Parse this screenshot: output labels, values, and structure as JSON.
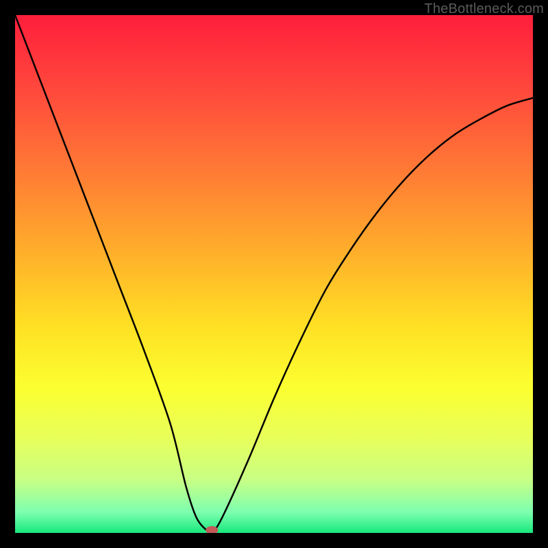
{
  "watermark": "TheBottleneck.com",
  "chart_data": {
    "type": "line",
    "title": "",
    "xlabel": "",
    "ylabel": "",
    "xlim": [
      0,
      100
    ],
    "ylim": [
      0,
      100
    ],
    "grid": false,
    "series": [
      {
        "name": "bottleneck-curve",
        "x": [
          0,
          5,
          10,
          15,
          20,
          25,
          30,
          33,
          35,
          37,
          38,
          40,
          45,
          50,
          55,
          60,
          65,
          70,
          75,
          80,
          85,
          90,
          95,
          100
        ],
        "values": [
          100,
          87,
          74,
          61,
          48,
          35,
          21,
          9,
          3,
          0.5,
          0,
          3,
          14,
          26,
          37,
          47,
          55,
          62,
          68,
          73,
          77,
          80,
          82.5,
          84
        ]
      }
    ],
    "marker": {
      "name": "optimal-point",
      "x": 38,
      "y": 0,
      "color": "#c25a57"
    },
    "gradient_stops": [
      {
        "offset": 0.0,
        "color": "#ff1e3c"
      },
      {
        "offset": 0.15,
        "color": "#ff4a3c"
      },
      {
        "offset": 0.3,
        "color": "#ff7a35"
      },
      {
        "offset": 0.45,
        "color": "#ffac2b"
      },
      {
        "offset": 0.6,
        "color": "#ffe024"
      },
      {
        "offset": 0.72,
        "color": "#fbff30"
      },
      {
        "offset": 0.82,
        "color": "#e7ff5c"
      },
      {
        "offset": 0.9,
        "color": "#c6ff86"
      },
      {
        "offset": 0.96,
        "color": "#7dffb0"
      },
      {
        "offset": 1.0,
        "color": "#18e87c"
      }
    ]
  }
}
